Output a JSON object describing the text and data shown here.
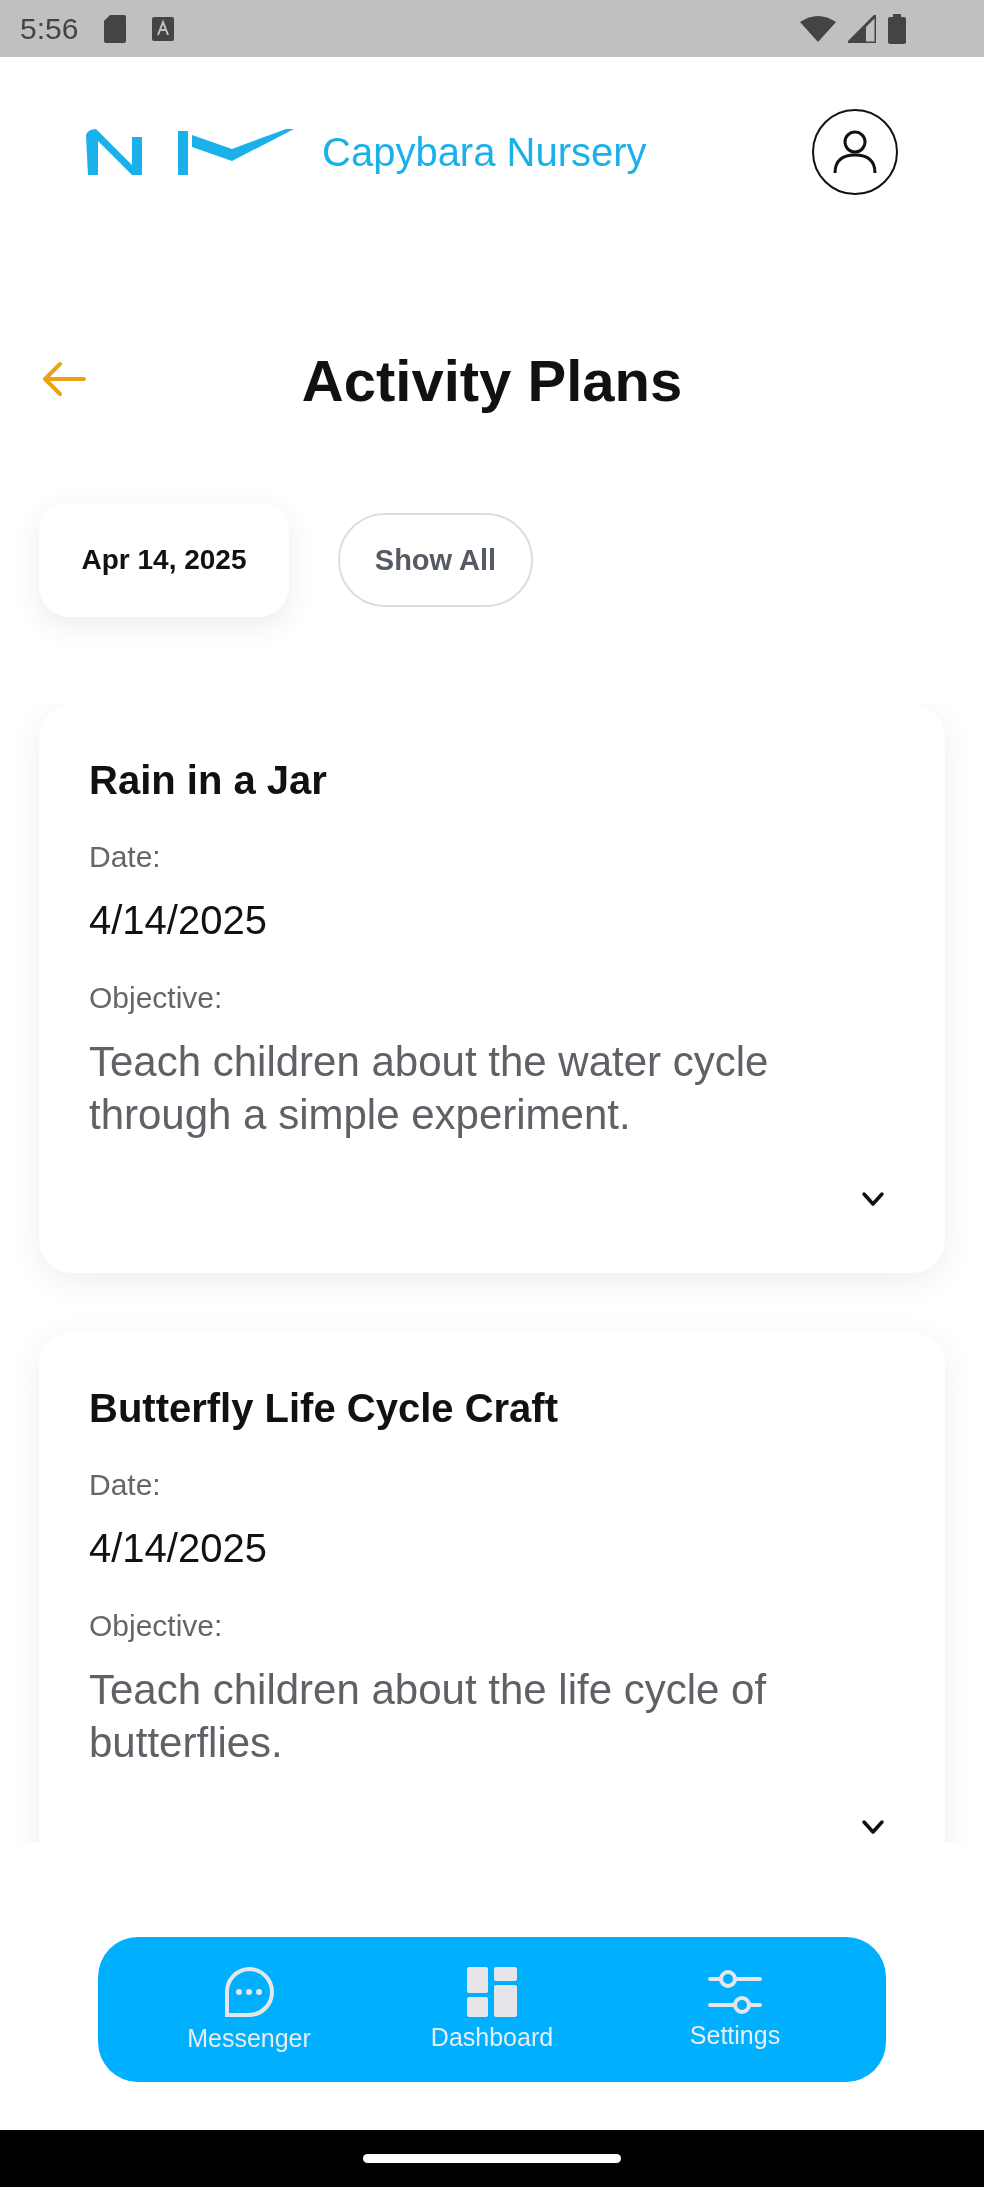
{
  "status_bar": {
    "time": "5:56"
  },
  "header": {
    "brand": "Capybara Nursery"
  },
  "page": {
    "title": "Activity Plans"
  },
  "filters": [
    {
      "label": "Apr 14, 2025",
      "kind": "date"
    },
    {
      "label": "Show All",
      "kind": "outline"
    }
  ],
  "activities": [
    {
      "title": "Rain in a Jar",
      "date_label": "Date:",
      "date": "4/14/2025",
      "objective_label": "Objective:",
      "objective": "Teach children about the water cycle through a simple experiment.",
      "expanded": false
    },
    {
      "title": "Butterfly Life Cycle Craft",
      "date_label": "Date:",
      "date": "4/14/2025",
      "objective_label": "Objective:",
      "objective": "Teach children about the life cycle of butterflies.",
      "expanded": false
    }
  ],
  "bottom_nav": [
    {
      "label": "Messenger",
      "kind": "chat"
    },
    {
      "label": "Dashboard",
      "kind": "dashboard"
    },
    {
      "label": "Settings",
      "kind": "sliders"
    }
  ]
}
